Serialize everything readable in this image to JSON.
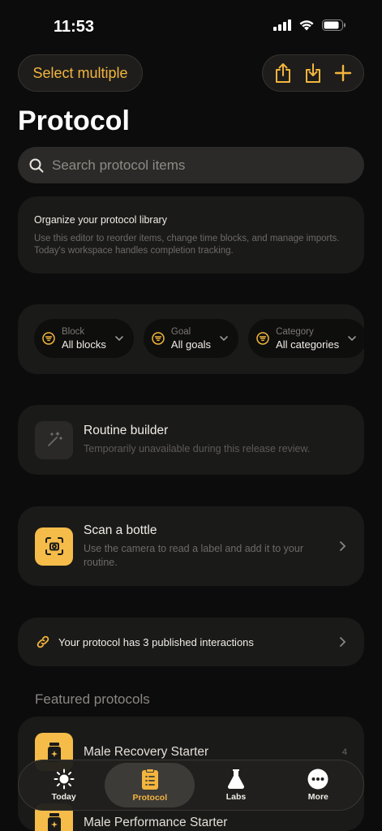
{
  "status": {
    "time": "11:53"
  },
  "header": {
    "select_multiple": "Select multiple",
    "title": "Protocol"
  },
  "search": {
    "placeholder": "Search protocol items"
  },
  "info": {
    "heading": "Organize your protocol library",
    "body": "Use this editor to reorder items, change time blocks, and manage imports. Today's workspace handles completion tracking."
  },
  "filters": [
    {
      "key": "Block",
      "value": "All blocks"
    },
    {
      "key": "Goal",
      "value": "All goals"
    },
    {
      "key": "Category",
      "value": "All categories"
    }
  ],
  "routine_builder": {
    "title": "Routine builder",
    "subtitle": "Temporarily unavailable during this release review."
  },
  "scan": {
    "title": "Scan a bottle",
    "subtitle": "Use the camera to read a label and add it to your routine."
  },
  "interactions": {
    "text": "Your protocol has 3 published interactions"
  },
  "featured": {
    "section_title": "Featured protocols",
    "items": [
      {
        "name": "Male Recovery Starter",
        "count": "4"
      },
      {
        "name": "Male Performance Starter",
        "count": ""
      }
    ]
  },
  "tabs": [
    {
      "label": "Today",
      "icon": "sun-icon"
    },
    {
      "label": "Protocol",
      "icon": "clipboard-icon",
      "active": true
    },
    {
      "label": "Labs",
      "icon": "flask-icon"
    },
    {
      "label": "More",
      "icon": "more-icon"
    }
  ],
  "colors": {
    "accent": "#F3B53D",
    "background": "#0C0C0C",
    "card": "#1A1A19"
  }
}
